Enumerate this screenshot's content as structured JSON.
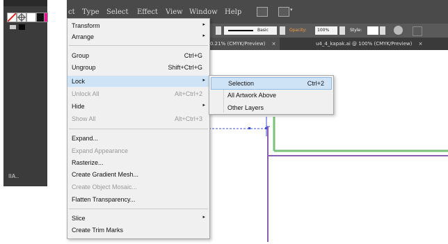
{
  "left_panel": {
    "bottom_text": "IIA.."
  },
  "menubar": {
    "items": [
      "ct",
      "Type",
      "Select",
      "Effect",
      "View",
      "Window",
      "Help"
    ]
  },
  "control_bar": {
    "stroke_label": "Basic",
    "opacity_label": "Opacity:",
    "opacity_value": "100%",
    "style_label": "Style:"
  },
  "tabs": [
    {
      "label": "0.21% (CMYK/Preview)",
      "close": "×"
    },
    {
      "label": "u4_4_kapak.ai @ 100% (CMYK/Preview)",
      "close": "×"
    }
  ],
  "object_menu": {
    "items": [
      {
        "label": "Transform",
        "shortcut": "",
        "submenu": true,
        "disabled": false
      },
      {
        "label": "Arrange",
        "shortcut": "",
        "submenu": true,
        "disabled": false
      },
      {
        "label": "Group",
        "shortcut": "Ctrl+G",
        "submenu": false,
        "disabled": false
      },
      {
        "label": "Ungroup",
        "shortcut": "Shift+Ctrl+G",
        "submenu": false,
        "disabled": false
      },
      {
        "label": "Lock",
        "shortcut": "",
        "submenu": true,
        "disabled": false,
        "highlighted": true
      },
      {
        "label": "Unlock All",
        "shortcut": "Alt+Ctrl+2",
        "submenu": false,
        "disabled": true
      },
      {
        "label": "Hide",
        "shortcut": "",
        "submenu": true,
        "disabled": false
      },
      {
        "label": "Show All",
        "shortcut": "Alt+Ctrl+3",
        "submenu": false,
        "disabled": true
      },
      {
        "label": "Expand...",
        "shortcut": "",
        "submenu": false,
        "disabled": false
      },
      {
        "label": "Expand Appearance",
        "shortcut": "",
        "submenu": false,
        "disabled": true
      },
      {
        "label": "Rasterize...",
        "shortcut": "",
        "submenu": false,
        "disabled": false
      },
      {
        "label": "Create Gradient Mesh...",
        "shortcut": "",
        "submenu": false,
        "disabled": false
      },
      {
        "label": "Create Object Mosaic...",
        "shortcut": "",
        "submenu": false,
        "disabled": true
      },
      {
        "label": "Flatten Transparency...",
        "shortcut": "",
        "submenu": false,
        "disabled": false
      },
      {
        "label": "Slice",
        "shortcut": "",
        "submenu": true,
        "disabled": false
      },
      {
        "label": "Create Trim Marks",
        "shortcut": "",
        "submenu": false,
        "disabled": false
      }
    ],
    "arrow_glyph": "▸"
  },
  "lock_submenu": {
    "items": [
      {
        "label": "Selection",
        "shortcut": "Ctrl+2",
        "highlighted": true
      },
      {
        "label": "All Artwork Above",
        "shortcut": ""
      },
      {
        "label": "Other Layers",
        "shortcut": ""
      }
    ]
  },
  "colors": {
    "menubar_bg": "#4a4a4a",
    "menu_bg": "#f0f0f0",
    "highlight": "#cfe3f7",
    "artboard_green": "#7ac27a",
    "artboard_purple": "#8a5fb0",
    "selection_blue": "#3b4fd6"
  }
}
